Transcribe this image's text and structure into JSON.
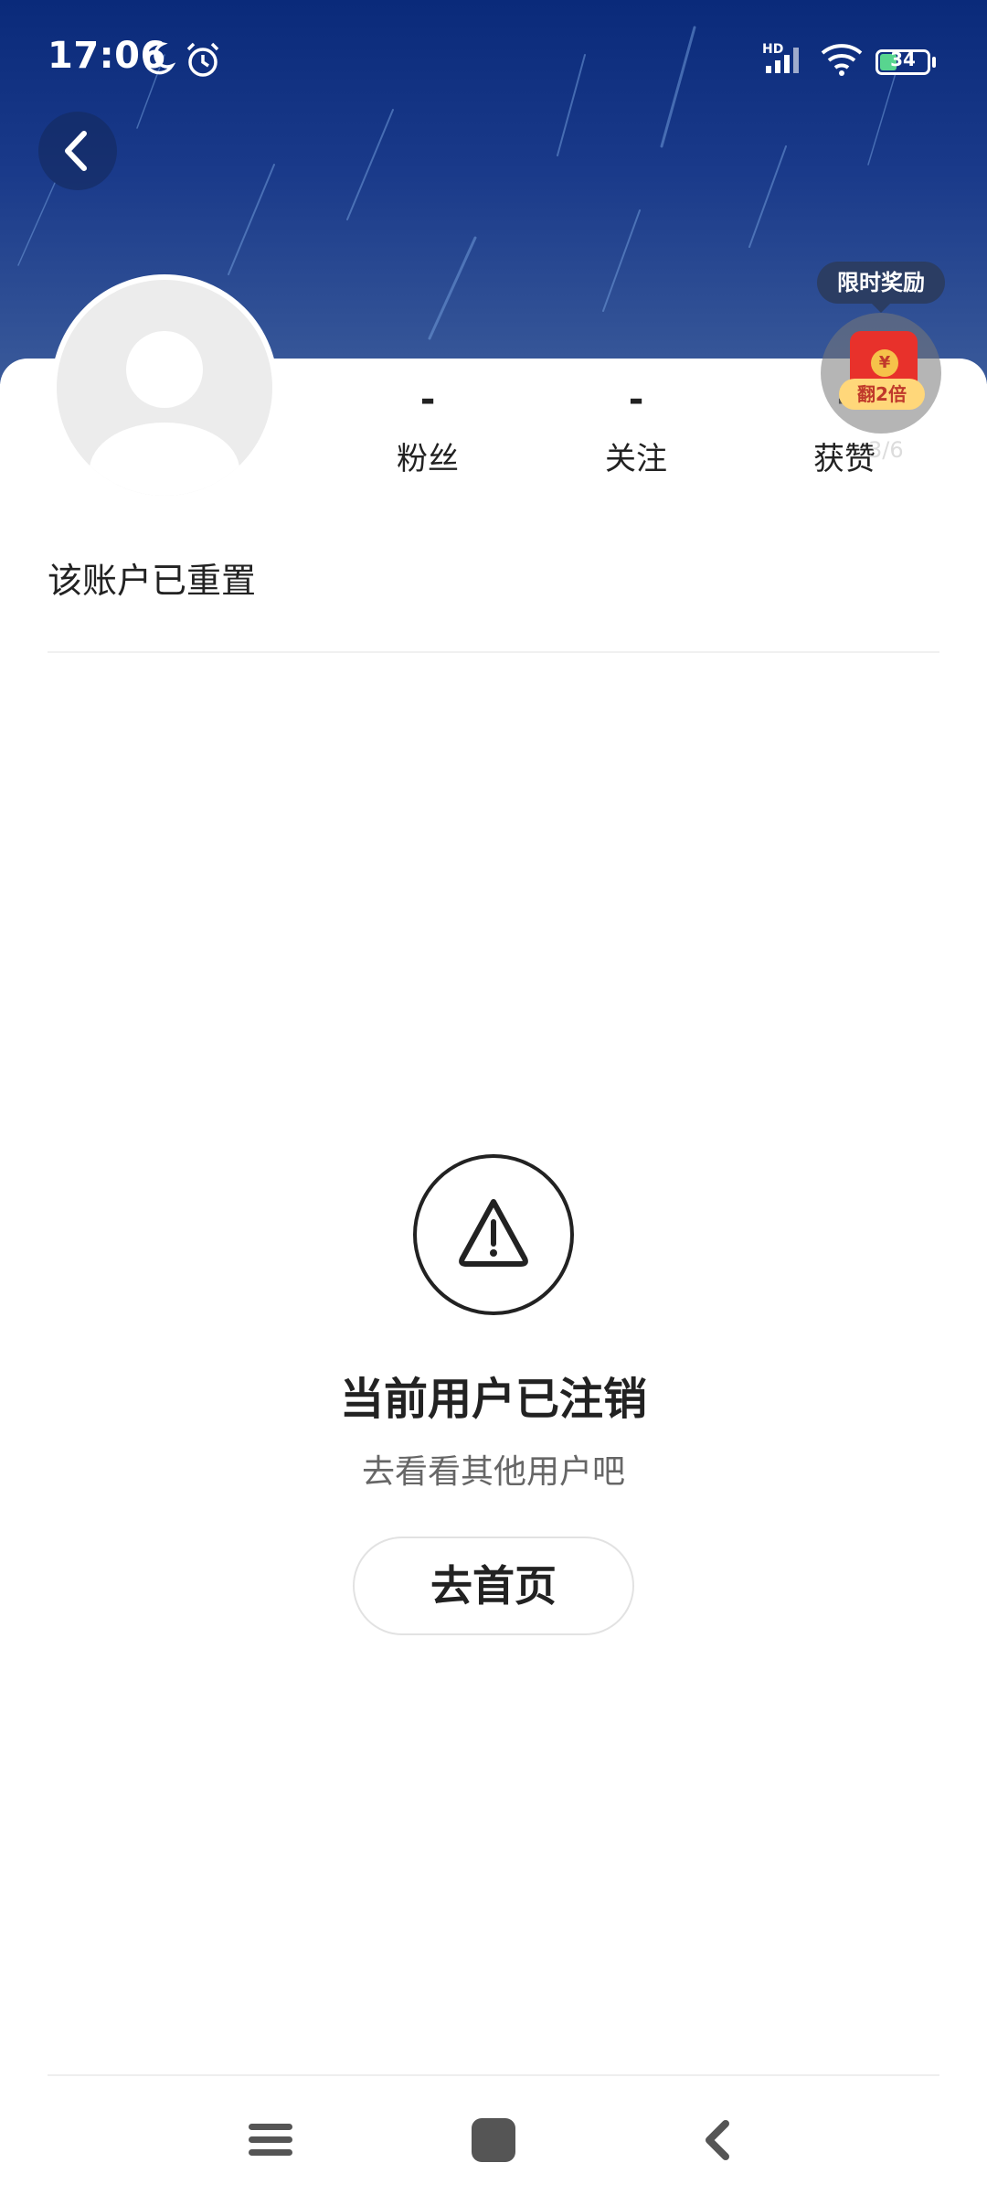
{
  "status_bar": {
    "time": "17:06",
    "network_label": "HD",
    "battery_level": "34",
    "battery_percent": 34
  },
  "profile": {
    "stats": [
      {
        "value": "-",
        "label": "粉丝"
      },
      {
        "value": "-",
        "label": "关注"
      },
      {
        "value": "-",
        "label": "获赞"
      }
    ],
    "account_name": "该账户已重置"
  },
  "reward": {
    "badge": "限时奖励",
    "coin": "¥",
    "tag": "翻2倍",
    "counter": "3/6"
  },
  "empty_state": {
    "title": "当前用户已注销",
    "subtitle": "去看看其他用户吧",
    "button": "去首页"
  },
  "colors": {
    "sky_top": "#0a2a7a",
    "reward_red": "#e8312b",
    "battery_green": "#58d58f"
  },
  "icons": [
    "moon-icon",
    "alarm-icon",
    "signal-icon",
    "wifi-icon",
    "battery-icon",
    "back-arrow-icon",
    "warning-icon",
    "menu-icon",
    "home-square-icon",
    "nav-back-icon"
  ]
}
